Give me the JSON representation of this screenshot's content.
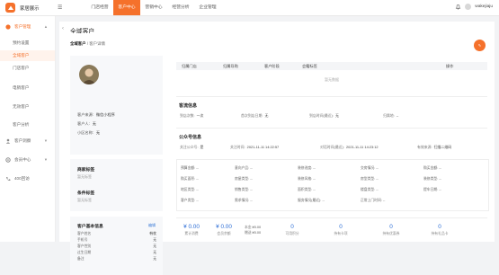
{
  "app": {
    "name": "家居展示",
    "accent_color": "#f5712b",
    "link_color": "#3c7bd6"
  },
  "topnav": [
    "门店经营",
    "客户中心",
    "营销中心",
    "经营分析",
    "企业管理"
  ],
  "topnav_active_index": 1,
  "user": {
    "name": "wakejiaju"
  },
  "sidebar": {
    "items": [
      {
        "label": "客户管理",
        "icon": "user-group-icon",
        "arrow": "^"
      },
      {
        "label": "预约设置"
      },
      {
        "label": "全域客户"
      },
      {
        "label": "门店客户"
      },
      {
        "label": "电销客户"
      },
      {
        "label": "无效客户"
      },
      {
        "label": "客户分析"
      },
      {
        "label": "客户洞察",
        "icon": "person-icon",
        "arrow": "v"
      },
      {
        "label": "会员中心",
        "icon": "gear-icon",
        "arrow": "v"
      },
      {
        "label": "400回访",
        "icon": "phone-icon"
      }
    ],
    "active_index": 2
  },
  "page": {
    "title": "全域客户",
    "breadcrumb": {
      "root": "全域客户",
      "sep": "/",
      "current": "客户详情"
    }
  },
  "profile": {
    "source_label": "客户来源:",
    "source_value": "微信小程序",
    "person_label": "客户人:",
    "person_value": "无",
    "nick_label": "小区名称:",
    "nick_value": "无"
  },
  "tags": {
    "title": "商家标签",
    "empty": "暂无标签",
    "cond_title": "条件标签",
    "cond_empty": "暂无标签"
  },
  "basic": {
    "title": "客户基本信息",
    "edit": "编辑",
    "rows": [
      {
        "label": "客户姓名",
        "value": "韩枕"
      },
      {
        "label": "手机号",
        "value": "无"
      },
      {
        "label": "客户性别",
        "value": "无"
      },
      {
        "label": "过生日期",
        "value": "无"
      },
      {
        "label": "备注",
        "value": "无"
      }
    ]
  },
  "table": {
    "headers": [
      "归属门店",
      "归属导购",
      "客户阶段",
      "会籍标签",
      "操作"
    ],
    "empty": "暂无数据"
  },
  "visit": {
    "title": "客流信息",
    "items": [
      {
        "label": "到店次数:",
        "value": "一次"
      },
      {
        "label": "首次到店日期:",
        "value": "无"
      },
      {
        "label": "到店时间(最近):",
        "value": "无"
      },
      {
        "label": "归属地:",
        "value": "--"
      }
    ]
  },
  "wechat": {
    "title": "公众号信息",
    "items": [
      {
        "label": "关注公众号:",
        "value": "是"
      },
      {
        "label": "关注时间:",
        "value": "2021-11-11 14:22:57"
      },
      {
        "label": "对话时间(最近):",
        "value": "2021-11-11 14:23:12"
      },
      {
        "label": "有效来源:",
        "value": "扫描二维码"
      }
    ]
  },
  "grid": [
    [
      "预算金额: --",
      "意向产品: --",
      "装修进度: --",
      "交房情况: --",
      "购买金额: --"
    ],
    [
      "购买面积: --",
      "房屋类型: --",
      "装修风格: --",
      "房型类型: --",
      "装修类型: --"
    ],
    [
      "地区类型: --",
      "销售类型: --",
      "面积类型: --",
      "楼盘类型: --",
      "提车日期: --"
    ],
    [
      "客户类型: --",
      "需求情况: --",
      "服务情况(最近): --",
      "正常上门时间: --"
    ]
  ],
  "stats": {
    "money": [
      {
        "num": "¥ 0.00",
        "label": "累计消费"
      },
      {
        "num": "¥ 0.00",
        "label": "会员余额"
      }
    ],
    "mini": [
      {
        "label": "本金:",
        "value": "¥0.00"
      },
      {
        "label": "赠送:",
        "value": "¥0.00"
      }
    ],
    "counts": [
      {
        "num": "0",
        "label": "可用积分"
      },
      {
        "num": "0",
        "label": "持有卡项"
      },
      {
        "num": "0",
        "label": "持有优惠券"
      },
      {
        "num": "0",
        "label": "持有礼品卡"
      }
    ]
  }
}
